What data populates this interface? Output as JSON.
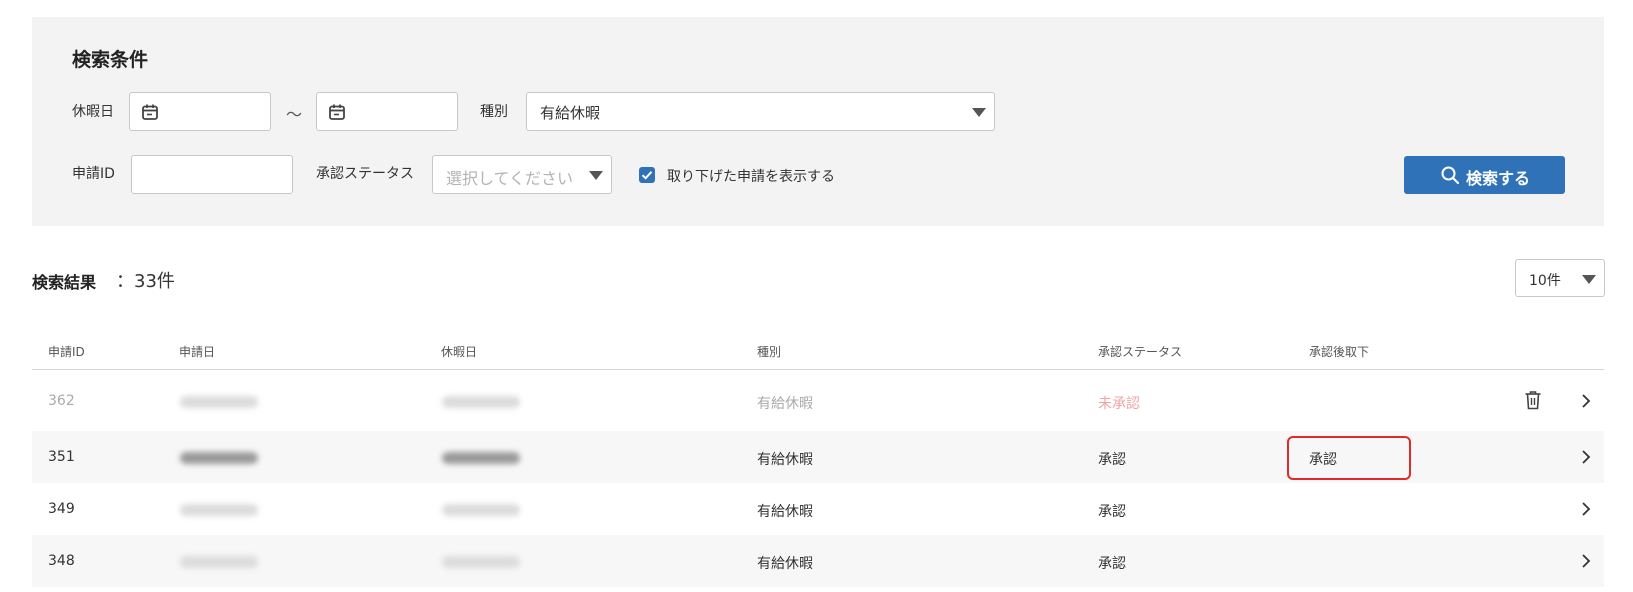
{
  "search": {
    "title": "検索条件",
    "holiday_label": "休暇日",
    "range_sep": "～",
    "type_label": "種別",
    "type_value": "有給休暇",
    "app_id_label": "申請ID",
    "status_label": "承認ステータス",
    "status_placeholder": "選択してください",
    "show_withdrawn_label": "取り下げた申請を表示する",
    "show_withdrawn_checked": true,
    "search_button": "検索する"
  },
  "results": {
    "title": "検索結果",
    "count": "：33件",
    "per_page": "10件"
  },
  "table": {
    "columns": [
      "申請ID",
      "申請日",
      "休暇日",
      "種別",
      "承認ステータス",
      "承認後取下"
    ],
    "rows": [
      {
        "id": "362",
        "type": "有給休暇",
        "status": "未承認",
        "withdrawn": ""
      },
      {
        "id": "351",
        "type": "有給休暇",
        "status": "承認",
        "withdrawn": "承認"
      },
      {
        "id": "349",
        "type": "有給休暇",
        "status": "承認",
        "withdrawn": ""
      },
      {
        "id": "348",
        "type": "有給休暇",
        "status": "承認",
        "withdrawn": ""
      }
    ]
  },
  "colors": {
    "primary": "#2f72b7",
    "panel_bg": "#f3f3f3",
    "unapproved": "#f0a5a5",
    "highlight": "#e02a2a"
  },
  "icons": [
    "calendar-icon",
    "chevron-down-icon",
    "check-icon",
    "search-icon",
    "trash-icon",
    "chevron-right-icon"
  ]
}
